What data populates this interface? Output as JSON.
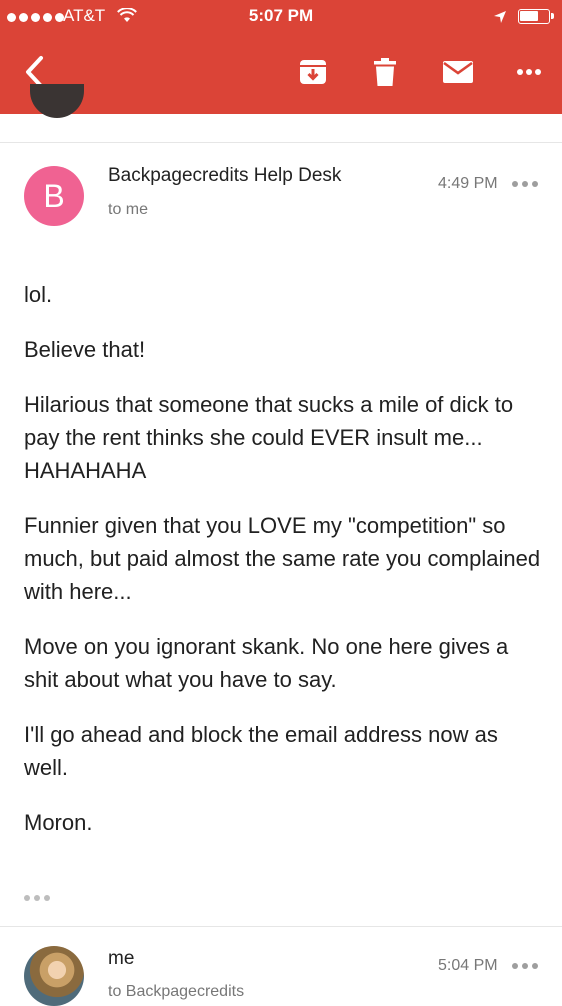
{
  "status_bar": {
    "carrier": "AT&T",
    "time": "5:07 PM"
  },
  "app_bar": {
    "icons": [
      "back-icon",
      "archive-icon",
      "trash-icon",
      "mail-icon",
      "more-icon"
    ],
    "color": "#db4437"
  },
  "message": {
    "avatar_letter": "B",
    "avatar_color": "#f06292",
    "sender": "Backpagecredits Help Desk",
    "recipient": "to me",
    "time": "4:49 PM",
    "body": [
      "lol.",
      "Believe that!",
      "Hilarious that someone that sucks a mile of dick to pay the rent thinks she could EVER insult me... HAHAHAHA",
      "Funnier given that you LOVE my \"competition\" so much, but paid almost the same rate you complained with here...",
      "Move on you ignorant skank. No one here gives a shit about what you have to say.",
      "I'll go ahead and block the email address now as well.",
      "Moron."
    ]
  },
  "reply": {
    "sender": "me",
    "recipient": "to Backpagecredits",
    "time": "5:04 PM"
  }
}
